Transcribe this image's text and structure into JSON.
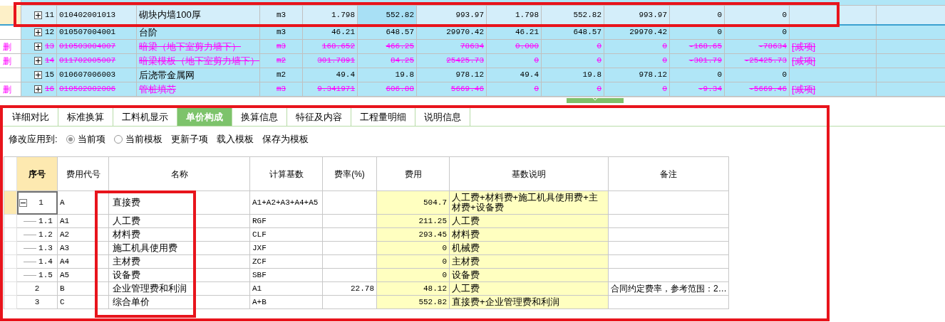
{
  "items_table": {
    "rows": [
      {
        "no": "11",
        "code": "010402001013",
        "name": "砌块内墙100厚",
        "unit": "m3",
        "qty": "1.798",
        "price": "552.82",
        "total": "993.97",
        "qty_2": "1.798",
        "price_2": "552.82",
        "total_2": "993.97",
        "column_12": "0",
        "column_13": "0",
        "expanded": false,
        "deleted": false,
        "selected": true
      },
      {
        "no": "12",
        "code": "010507004001",
        "name": "台阶",
        "unit": "m3",
        "qty": "46.21",
        "price": "648.57",
        "total": "29970.42",
        "qty_2": "46.21",
        "price_2": "648.57",
        "total_2": "29970.42",
        "column_12": "0",
        "column_13": "0",
        "expanded": false,
        "deleted": false,
        "selected": false
      },
      {
        "mark": "删",
        "no": "13",
        "code": "010503004007",
        "name": "暗梁（地下室剪力墙下）",
        "unit": "m3",
        "qty": "168.652",
        "price": "466.25",
        "total": "78634",
        "qty_2": "0.000",
        "price_2": "0",
        "total_2": "0",
        "column_12": "-168.65",
        "column_13": "-78634",
        "remark": "[减项]",
        "expanded": false,
        "deleted": true,
        "selected": false
      },
      {
        "mark": "删",
        "no": "14",
        "code": "011702005007",
        "name": "暗梁模板（地下室剪力墙下）",
        "unit": "m2",
        "qty": "301.7891",
        "price": "84.25",
        "total": "25425.73",
        "qty_2": "0",
        "price_2": "0",
        "total_2": "0",
        "column_12": "-301.79",
        "column_13": "-25425.73",
        "remark": "[减项]",
        "expanded": false,
        "deleted": true,
        "selected": false
      },
      {
        "no": "15",
        "code": "010607006003",
        "name": "后浇带金属网",
        "unit": "m2",
        "qty": "49.4",
        "price": "19.8",
        "total": "978.12",
        "qty_2": "49.4",
        "price_2": "19.8",
        "total_2": "978.12",
        "column_12": "0",
        "column_13": "0",
        "expanded": false,
        "deleted": false,
        "selected": false
      },
      {
        "mark": "删",
        "no": "16",
        "code": "010502002006",
        "name": "管桩填芯",
        "unit": "m3",
        "qty": "9.341971",
        "price": "606.88",
        "total": "5669.46",
        "qty_2": "0",
        "price_2": "0",
        "total_2": "0",
        "column_12": "-9.34",
        "column_13": "-5669.46",
        "remark": "[减项]",
        "expanded": false,
        "deleted": true,
        "selected": false
      }
    ]
  },
  "tabs": [
    {
      "label": "详细对比",
      "selected": false
    },
    {
      "label": "标准换算",
      "selected": false
    },
    {
      "label": "工料机显示",
      "selected": false
    },
    {
      "label": "单价构成",
      "selected": true
    },
    {
      "label": "换算信息",
      "selected": false
    },
    {
      "label": "特征及内容",
      "selected": false
    },
    {
      "label": "工程量明细",
      "selected": false
    },
    {
      "label": "说明信息",
      "selected": false
    }
  ],
  "toolbar": {
    "apply_label": "修改应用到:",
    "options": [
      {
        "label": "当前项",
        "selected": true
      },
      {
        "label": "当前模板",
        "selected": false
      }
    ],
    "buttons": [
      "更新子项",
      "载入模板",
      "保存为模板"
    ]
  },
  "price_table": {
    "columns": [
      "序号",
      "费用代号",
      "名称",
      "计算基数",
      "费率(%)",
      "费用",
      "基数说明",
      "备注"
    ],
    "rows": [
      {
        "seq": "1",
        "code": "A",
        "name": "直接费",
        "base": "A1+A2+A3+A4+A5",
        "fee": "504.7",
        "desc": "人工费+材料费+施工机具使用费+主材费+设备费",
        "selected": true,
        "expanded": true,
        "children": [
          {
            "seq": "1.1",
            "code": "A1",
            "name": "人工费",
            "base": "RGF",
            "fee": "211.25",
            "desc": "人工费",
            "selected": false
          },
          {
            "seq": "1.2",
            "code": "A2",
            "name": "材料费",
            "base": "CLF",
            "fee": "293.45",
            "desc": "材料费",
            "selected": false
          },
          {
            "seq": "1.3",
            "code": "A3",
            "name": "施工机具使用费",
            "base": "JXF",
            "fee": "0",
            "desc": "机械费",
            "selected": false
          },
          {
            "seq": "1.4",
            "code": "A4",
            "name": "主材费",
            "base": "ZCF",
            "fee": "0",
            "desc": "主材费",
            "selected": false
          },
          {
            "seq": "1.5",
            "code": "A5",
            "name": "设备费",
            "base": "SBF",
            "fee": "0",
            "desc": "设备费",
            "selected": false
          }
        ]
      },
      {
        "seq": "2",
        "code": "B",
        "name": "企业管理费和利润",
        "base": "A1",
        "rate": "22.78",
        "fee": "48.12",
        "desc": "人工费",
        "note": "合同约定费率，参考范围：2…",
        "selected": false
      },
      {
        "seq": "3",
        "code": "C",
        "name": "综合单价",
        "base": "A+B",
        "fee": "552.82",
        "desc": "直接费+企业管理费和利润",
        "selected": false
      }
    ]
  }
}
